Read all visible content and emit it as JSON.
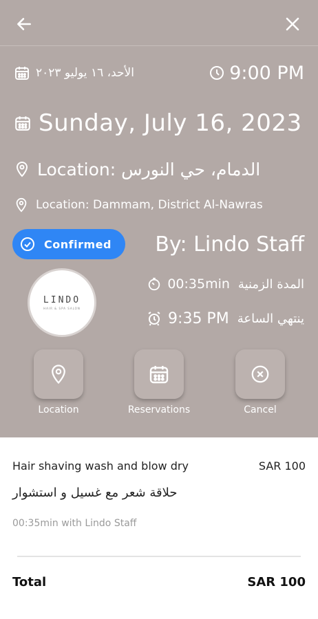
{
  "appointment": {
    "date_ar": "الأحد، ١٦ يوليو ٢٠٢٣",
    "time": "9:00 PM",
    "date_en": "Sunday, July 16, 2023",
    "location_ar": "الدمام، حي النورس :Location",
    "location_en": "Location: Dammam, District Al-Nawras",
    "status": "Confirmed",
    "staff": "By: Lindo Staff",
    "duration_label_ar": "المدة الزمنية",
    "duration": "00:35min",
    "ends_label_ar": "ينتهي الساعة",
    "end_time": "9:35 PM"
  },
  "logo": {
    "text": "LINDO",
    "sub": "HAIR & SPA SALON"
  },
  "actions": [
    {
      "label": "Location",
      "icon": "location-pin-icon"
    },
    {
      "label": "Reservations",
      "icon": "calendar-icon"
    },
    {
      "label": "Cancel",
      "icon": "cancel-icon"
    }
  ],
  "service": {
    "name_en": "Hair shaving wash and blow dry",
    "name_ar": "حلاقة شعر مع غسيل و استشوار",
    "price": "SAR 100",
    "meta": "00:35min with Lindo Staff"
  },
  "total": {
    "label": "Total",
    "value": "SAR 100"
  },
  "colors": {
    "header_bg": "#b3a9a6",
    "badge": "#2f86f5",
    "text_white": "#ffffff"
  }
}
